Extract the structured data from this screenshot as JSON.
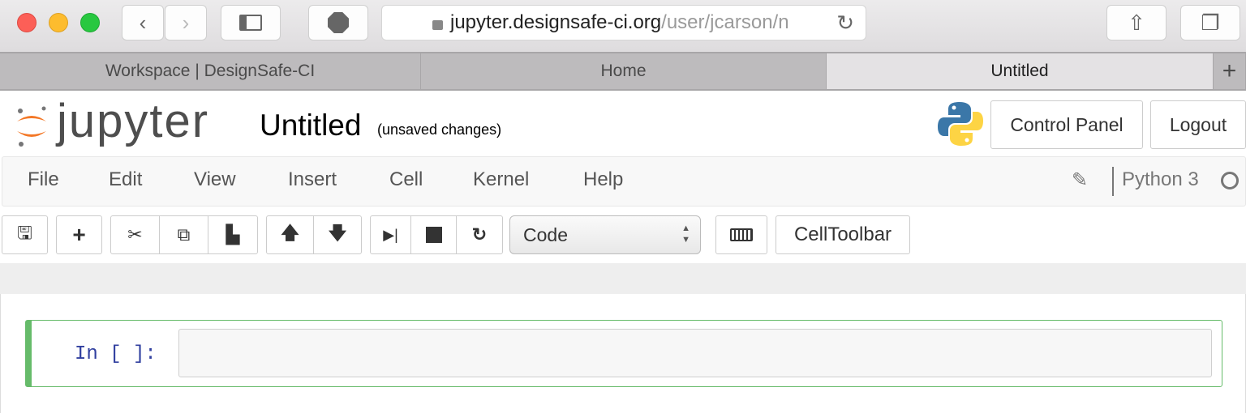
{
  "browser": {
    "url_main": "jupyter.designsafe-ci.org",
    "url_rest": "/user/jcarson/n",
    "tabs": [
      {
        "label": "Workspace | DesignSafe-CI"
      },
      {
        "label": "Home"
      },
      {
        "label": "Untitled"
      }
    ],
    "new_tab": "+"
  },
  "header": {
    "logo": "jupyter",
    "notebook_title": "Untitled",
    "save_status": "(unsaved changes)",
    "control_panel": "Control Panel",
    "logout": "Logout"
  },
  "menubar": {
    "items": [
      "File",
      "Edit",
      "View",
      "Insert",
      "Cell",
      "Kernel",
      "Help"
    ],
    "kernel_name": "Python 3"
  },
  "toolbar": {
    "cell_type": "Code",
    "celltoolbar": "CellToolbar"
  },
  "cell": {
    "prompt": "In [ ]:",
    "source": ""
  },
  "colors": {
    "accent_green": "#66bb6a",
    "prompt_blue": "#303f9f",
    "jupyter_orange": "#f37726"
  }
}
